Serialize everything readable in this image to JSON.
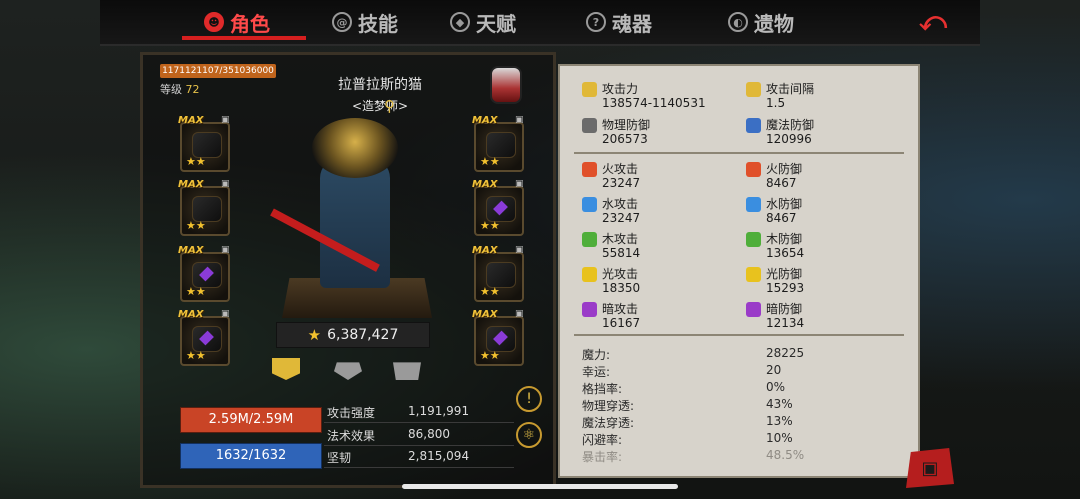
{
  "nav": {
    "tabs": [
      {
        "label": "角色",
        "icon": "demon-face-icon",
        "active": true
      },
      {
        "label": "技能",
        "icon": "swirl-icon",
        "active": false
      },
      {
        "label": "天赋",
        "icon": "diamond-crest-icon",
        "active": false
      },
      {
        "label": "魂器",
        "icon": "soul-orb-icon",
        "active": false
      },
      {
        "label": "遗物",
        "icon": "relic-icon",
        "active": false
      }
    ],
    "back_icon": "back-arrow-icon",
    "active_color": "#ff4a4a"
  },
  "character": {
    "exp_text": "1171121107/351036000",
    "exp_fraction": 1.0,
    "level_label": "等级",
    "level_value": "72",
    "name": "拉普拉斯的猫",
    "class": "<造梦师>",
    "power": "6,387,427"
  },
  "equipment": {
    "max_label": "MAX",
    "slots": [
      {
        "side": "left",
        "stars": "★★"
      },
      {
        "side": "left",
        "stars": "★★"
      },
      {
        "side": "left",
        "stars": "★★"
      },
      {
        "side": "left",
        "stars": "★★"
      },
      {
        "side": "right",
        "stars": "★★"
      },
      {
        "side": "right",
        "stars": "★★"
      },
      {
        "side": "right",
        "stars": "★★"
      },
      {
        "side": "right",
        "stars": "★★"
      }
    ]
  },
  "vitals": {
    "hp": "2.59M/2.59M",
    "mp": "1632/1632",
    "combat": [
      {
        "label": "攻击强度",
        "value": "1,191,991"
      },
      {
        "label": "法术效果",
        "value": "86,800"
      },
      {
        "label": "坚韧",
        "value": "2,815,094"
      }
    ]
  },
  "stats": {
    "primary": [
      {
        "label": "攻击力",
        "value": "138574-1140531",
        "icon": "sword-icon",
        "color": "#e0b838"
      },
      {
        "label": "攻击间隔",
        "value": "1.5",
        "icon": "speed-sword-icon",
        "color": "#e0b838"
      },
      {
        "label": "物理防御",
        "value": "206573",
        "icon": "armor-icon",
        "color": "#6b6b6b"
      },
      {
        "label": "魔法防御",
        "value": "120996",
        "icon": "magic-armor-icon",
        "color": "#3b6fc4"
      }
    ],
    "elements": [
      {
        "label": "火攻击",
        "value": "23247",
        "icon": "fire-attack-icon",
        "color": "#e0502a"
      },
      {
        "label": "火防御",
        "value": "8467",
        "icon": "fire-defense-icon",
        "color": "#e0502a"
      },
      {
        "label": "水攻击",
        "value": "23247",
        "icon": "water-attack-icon",
        "color": "#3a8ee0"
      },
      {
        "label": "水防御",
        "value": "8467",
        "icon": "water-defense-icon",
        "color": "#3a8ee0"
      },
      {
        "label": "木攻击",
        "value": "55814",
        "icon": "wood-attack-icon",
        "color": "#4fae3a"
      },
      {
        "label": "木防御",
        "value": "13654",
        "icon": "wood-defense-icon",
        "color": "#4fae3a"
      },
      {
        "label": "光攻击",
        "value": "18350",
        "icon": "light-attack-icon",
        "color": "#e8c21e"
      },
      {
        "label": "光防御",
        "value": "15293",
        "icon": "light-defense-icon",
        "color": "#e8c21e"
      },
      {
        "label": "暗攻击",
        "value": "16167",
        "icon": "dark-attack-icon",
        "color": "#9a3bc8"
      },
      {
        "label": "暗防御",
        "value": "12134",
        "icon": "dark-defense-icon",
        "color": "#9a3bc8"
      }
    ],
    "misc": [
      {
        "label": "魔力:",
        "value": "28225"
      },
      {
        "label": "幸运:",
        "value": "20"
      },
      {
        "label": "格挡率:",
        "value": "0%"
      },
      {
        "label": "物理穿透:",
        "value": "43%"
      },
      {
        "label": "魔法穿透:",
        "value": "13%"
      },
      {
        "label": "闪避率:",
        "value": "10%"
      },
      {
        "label": "暴击率:",
        "value": "48.5%"
      }
    ]
  }
}
